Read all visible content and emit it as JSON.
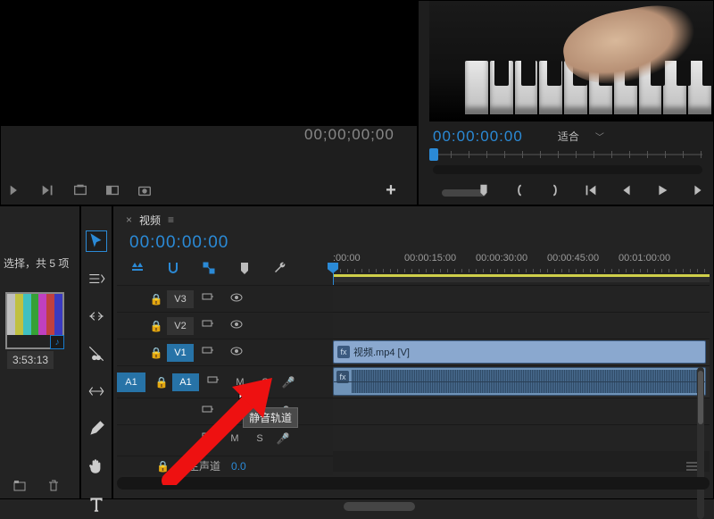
{
  "source": {
    "timecode": "00;00;00;00",
    "controls": [
      "insert",
      "overwrite",
      "export-frame",
      "mark-in",
      "snapshot"
    ],
    "add_label": "+"
  },
  "program": {
    "timecode": "00:00:00:00",
    "fit_label": "适合",
    "transport": [
      "marker",
      "in-bracket",
      "out-bracket",
      "goto-in",
      "step-back",
      "play",
      "step-fwd"
    ]
  },
  "project": {
    "info": "选择，共 5 项",
    "clip_duration": "3:53:13"
  },
  "tools": [
    "selection",
    "track-select",
    "ripple",
    "razor",
    "rolling",
    "pen",
    "hand",
    "type"
  ],
  "timeline": {
    "tab_label": "视频",
    "timecode": "00:00:00:00",
    "ruler": [
      ":00:00",
      "00:00:15:00",
      "00:00:30:00",
      "00:00:45:00",
      "00:01:00:00"
    ],
    "tracks": {
      "v3": "V3",
      "v2": "V2",
      "v1": "V1",
      "a1_src": "A1",
      "a1": "A1",
      "mute": "M",
      "solo": "S"
    },
    "clip_label": "视频.mp4 [V]",
    "tooltip": "静音轨道",
    "master_label": "主声道",
    "master_value": "0.0"
  }
}
